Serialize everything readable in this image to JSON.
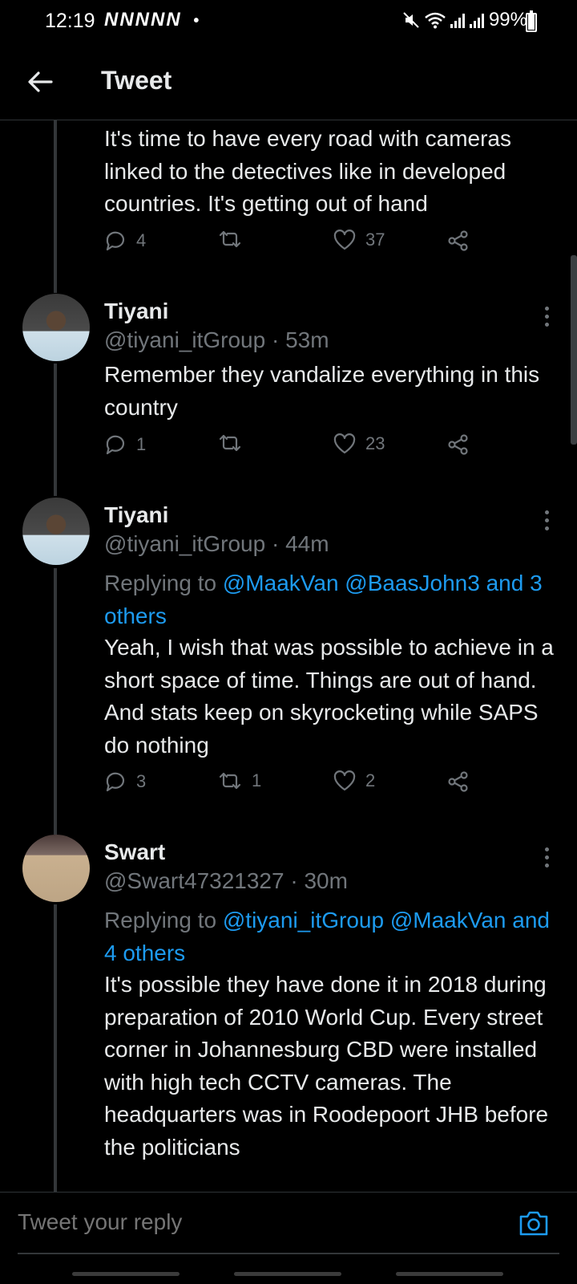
{
  "status_bar": {
    "time": "12:19",
    "notification_icons": "NNNNN",
    "dot": "•",
    "battery": "99%",
    "battery_level": 0.99
  },
  "header": {
    "title": "Tweet"
  },
  "top_tweet": {
    "text": "It's time to have every road with cameras linked to the detectives like in developed countries. It's getting out of hand",
    "replies": "4",
    "retweets": "",
    "likes": "37"
  },
  "tweets": [
    {
      "name": "Tiyani",
      "handle": "@tiyani_itGroup",
      "time": "· 53m",
      "text": "Remember they vandalize everything in this country",
      "replies": "1",
      "retweets": "",
      "likes": "23"
    },
    {
      "name": "Tiyani",
      "handle": "@tiyani_itGroup",
      "time": "· 44m",
      "replying_prefix": "Replying to ",
      "replying_mentions": "@MaakVan @BaasJohn3 and 3 others",
      "text": "Yeah, I wish that was possible to achieve in a short space of time. Things are out of hand. And stats keep on skyrocketing while SAPS do nothing",
      "replies": "3",
      "retweets": "1",
      "likes": "2"
    },
    {
      "name": "Swart",
      "handle": "@Swart47321327",
      "time": "· 30m",
      "replying_prefix": "Replying to ",
      "replying_mentions": "@tiyani_itGroup @MaakVan and 4 others",
      "text": "It's possible they have done it in 2018 during preparation of 2010 World Cup. Every street corner in Johannesburg CBD were installed with high tech CCTV cameras. The headquarters was in Roodepoort JHB before the politicians"
    }
  ],
  "compose": {
    "placeholder": "Tweet your reply"
  },
  "icons": {
    "back": "arrow-left-icon",
    "reply": "reply-icon",
    "retweet": "retweet-icon",
    "like": "heart-icon",
    "share": "share-icon",
    "more": "more-icon",
    "camera": "camera-icon"
  },
  "colors": {
    "background": "#000000",
    "text": "#e7e9ea",
    "muted": "#71767b",
    "accent": "#1d9bf0"
  }
}
